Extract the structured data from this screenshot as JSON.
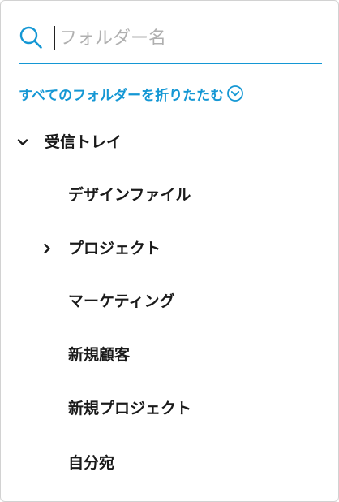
{
  "search": {
    "placeholder": "フォルダー名",
    "value": ""
  },
  "collapse_all": {
    "label": "すべてのフォルダーを折りたたむ",
    "icon": "chevron-down-circle-icon"
  },
  "folders": [
    {
      "label": "受信トレイ",
      "expanded": true,
      "chevron": "chevron-down-icon"
    },
    {
      "label": "デザインファイル"
    },
    {
      "label": "プロジェクト",
      "expanded": false,
      "chevron": "chevron-right-icon"
    },
    {
      "label": "マーケティング"
    },
    {
      "label": "新規顧客"
    },
    {
      "label": "新規プロジェクト"
    },
    {
      "label": "自分宛"
    }
  ],
  "colors": {
    "accent": "#1497d4",
    "text": "#1a1a1a",
    "placeholder": "#b0b0b0",
    "border": "#d2d2d2"
  }
}
